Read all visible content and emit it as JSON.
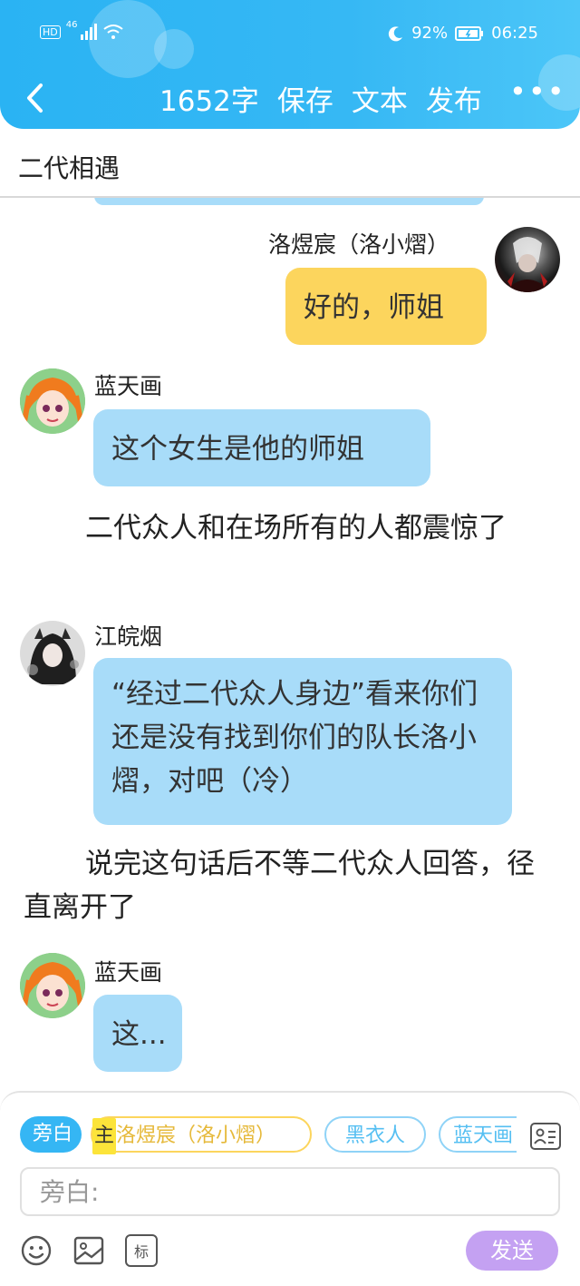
{
  "status_bar": {
    "network": "HD",
    "signal_label": "46",
    "battery": "92%",
    "time": "06:25"
  },
  "toolbar": {
    "word_count": "1652字",
    "save": "保存",
    "text": "文本",
    "publish": "发布",
    "more": "•••"
  },
  "title": "二代相遇",
  "messages": [
    {
      "type": "message",
      "side": "right",
      "name": "洛煜宸（洛小熠）",
      "text": "好的，师姐",
      "bubble_color": "#fcd55d"
    },
    {
      "type": "message",
      "side": "left",
      "name": "蓝天画",
      "text": "这个女生是他的师姐",
      "bubble_color": "#a8dcf9"
    },
    {
      "type": "narration",
      "text": "二代众人和在场所有的人都震惊了"
    },
    {
      "type": "message",
      "side": "left",
      "name": "江皖烟",
      "text": "“经过二代众人身边”看来你们还是没有找到你们的队长洛小熠，对吧（冷）",
      "bubble_color": "#a8dcf9"
    },
    {
      "type": "narration",
      "text": "说完这句话后不等二代众人回答，径直离开了"
    },
    {
      "type": "message",
      "side": "left",
      "name": "蓝天画",
      "text": "这...",
      "bubble_color": "#a8dcf9"
    }
  ],
  "roles": [
    {
      "label": "旁白",
      "selected": true
    },
    {
      "badge": "主",
      "label": "洛煜宸（洛小熠）",
      "selected": false,
      "color": "#fcd55d"
    },
    {
      "label": "黑衣人",
      "selected": false,
      "color": "#8fd3f7"
    },
    {
      "label": "蓝天画",
      "selected": false,
      "color": "#8fd3f7"
    }
  ],
  "input": {
    "placeholder": "旁白:"
  },
  "send_label": "发送",
  "bottom_icons": [
    "emoji-icon",
    "image-icon",
    "tag-icon"
  ],
  "tag_icon_label": "标",
  "colors": {
    "header": "#2ab3f3",
    "blue_bubble": "#a8dcf9",
    "yellow_bubble": "#fcd55d",
    "send_button": "#c4a1f2",
    "chip_selected": "#35b6f4"
  }
}
